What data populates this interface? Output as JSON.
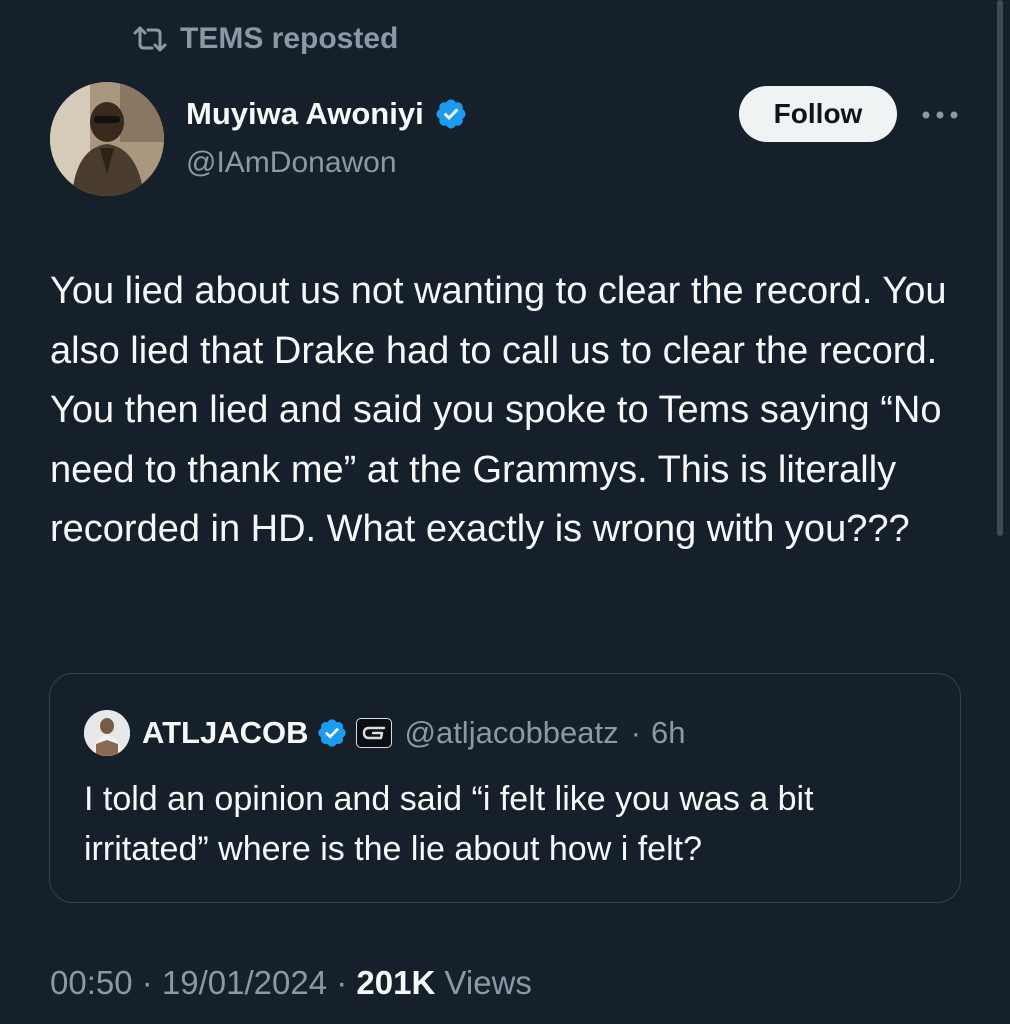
{
  "repost": {
    "label": "TEMS reposted",
    "icon": "repost-icon"
  },
  "author": {
    "name": "Muyiwa Awoniyi",
    "handle": "@IAmDonawon",
    "verified": true,
    "avatar_icon": "avatar"
  },
  "follow_label": "Follow",
  "more_icon": "more-icon",
  "tweet_text": "You lied about us not wanting to clear the record. You also lied that Drake had to call us to clear the record. You then lied and said you spoke to Tems saying “No need to thank me” at the Grammys. This is literally recorded in HD. What exactly  is wrong with you???",
  "quoted": {
    "name": "ATLJACOB",
    "handle": "@atljacobbeatz",
    "separator": "·",
    "time": "6h",
    "text": "I told an opinion and said “i felt like you was a bit irritated” where is the lie about how i felt?"
  },
  "meta": {
    "time": "00:50",
    "sep1": " · ",
    "date": "19/01/2024",
    "sep2": " · ",
    "views_count": "201K",
    "views_label": " Views"
  },
  "colors": {
    "background": "#15202b",
    "text": "#f7f9f9",
    "muted": "#8b98a5",
    "verified": "#1d9bf0",
    "border": "#38444d"
  }
}
